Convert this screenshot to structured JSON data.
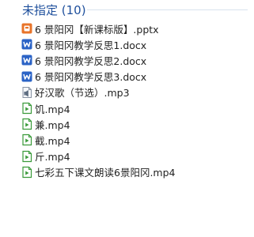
{
  "group": {
    "title": "未指定 (10)"
  },
  "files": [
    {
      "name": "6 景阳冈【新课标版】.pptx",
      "icon": "pptx-file-icon",
      "type": "pptx",
      "color": "#e8742a"
    },
    {
      "name": "6 景阳冈教学反思1.docx",
      "icon": "docx-file-icon",
      "type": "docx",
      "color": "#2b63c6"
    },
    {
      "name": "6 景阳冈教学反思2.docx",
      "icon": "docx-file-icon",
      "type": "docx",
      "color": "#2b63c6"
    },
    {
      "name": "6 景阳冈教学反思3.docx",
      "icon": "docx-file-icon",
      "type": "docx",
      "color": "#2b63c6"
    },
    {
      "name": "好汉歌（节选）.mp3",
      "icon": "audio-file-icon",
      "type": "mp3",
      "color": "#5a6a7e"
    },
    {
      "name": "饥.mp4",
      "icon": "video-file-icon",
      "type": "mp4",
      "color": "#3a9a3a"
    },
    {
      "name": "兼.mp4",
      "icon": "video-file-icon",
      "type": "mp4",
      "color": "#3a9a3a"
    },
    {
      "name": "截.mp4",
      "icon": "video-file-icon",
      "type": "mp4",
      "color": "#3a9a3a"
    },
    {
      "name": "斤.mp4",
      "icon": "video-file-icon",
      "type": "mp4",
      "color": "#3a9a3a"
    },
    {
      "name": "七彩五下课文朗读6景阳冈.mp4",
      "icon": "video-file-icon",
      "type": "mp4",
      "color": "#3a9a3a"
    }
  ]
}
